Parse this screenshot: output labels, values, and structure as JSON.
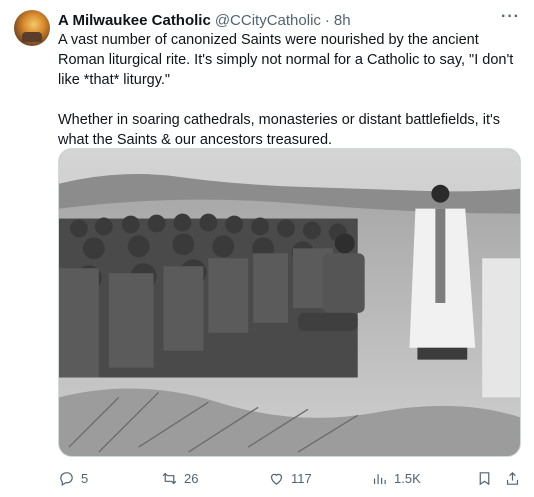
{
  "author": {
    "display_name": "A Milwaukee Catholic",
    "handle": "@CCityCatholic",
    "separator": "·",
    "time": "8h",
    "more_glyph": "···"
  },
  "tweet": {
    "paragraph1": "A vast number of canonized Saints were nourished by the ancient Roman liturgical rite. It's simply not normal for a Catholic to say, \"I don't like *that* liturgy.\"",
    "paragraph2": "Whether in soaring cathedrals, monasteries or distant battlefields, it's what the Saints & our ancestors treasured."
  },
  "media": {
    "kind": "black-and-white photo of soldiers kneeling at a field Mass"
  },
  "actions": {
    "replies": "5",
    "reposts": "26",
    "likes": "117",
    "views": "1.5K"
  },
  "icons": {
    "reply": "reply-icon",
    "repost": "repost-icon",
    "like": "like-icon",
    "views": "views-icon",
    "bookmark": "bookmark-icon",
    "share": "share-icon"
  }
}
